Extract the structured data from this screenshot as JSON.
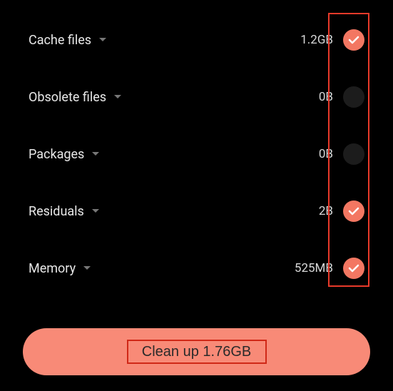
{
  "items": [
    {
      "label": "Cache files",
      "size": "1.2GB",
      "checked": true
    },
    {
      "label": "Obsolete files",
      "size": "0B",
      "checked": false
    },
    {
      "label": "Packages",
      "size": "0B",
      "checked": false
    },
    {
      "label": "Residuals",
      "size": "2B",
      "checked": true
    },
    {
      "label": "Memory",
      "size": "525MB",
      "checked": true
    }
  ],
  "button": {
    "label": "Clean up 1.76GB"
  }
}
